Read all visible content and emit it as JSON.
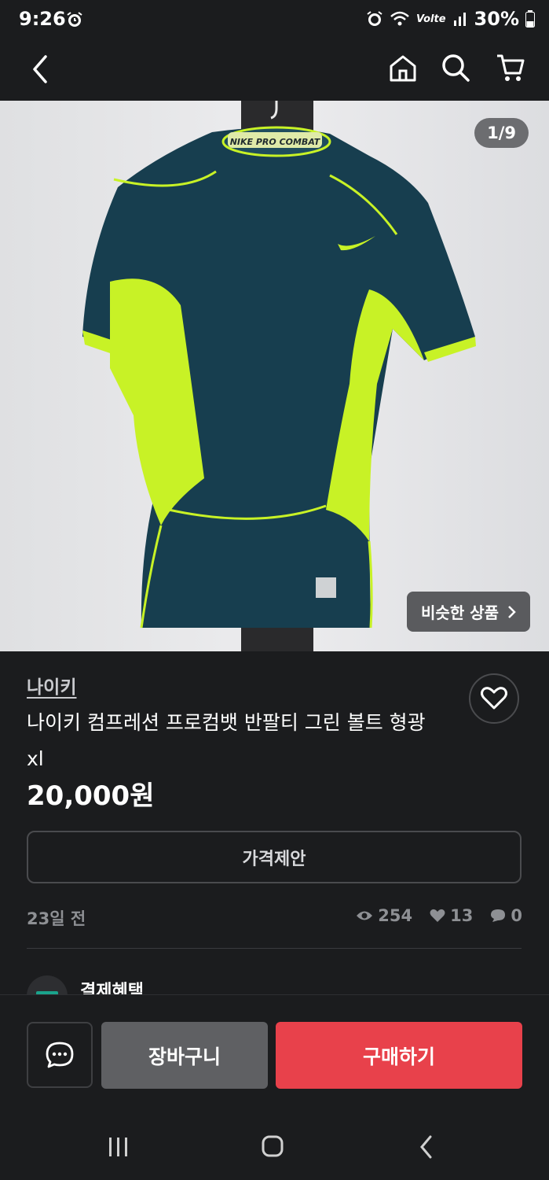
{
  "status_bar": {
    "time": "9:26",
    "network": "Volte",
    "battery": "30%"
  },
  "hero": {
    "pager": "1/9",
    "similar_label": "비슷한 상품",
    "tag_text": "NIKE PRO COMBAT"
  },
  "product": {
    "brand": "나이키",
    "title": "나이키 컴프레션 프로컴뱃 반팔티 그린 볼트 형광 xl",
    "price": "20,000원",
    "offer_label": "가격제안",
    "posted": "23일 전",
    "views": "254",
    "likes": "13",
    "chats": "0"
  },
  "benefit": {
    "label": "결제혜택"
  },
  "actions": {
    "cart_label": "장바구니",
    "buy_label": "구매하기"
  },
  "colors": {
    "background": "#1b1c1e",
    "buy": "#e8414b",
    "cart": "#5f6063",
    "shirt": "#173e4f",
    "neon": "#c8f226"
  }
}
